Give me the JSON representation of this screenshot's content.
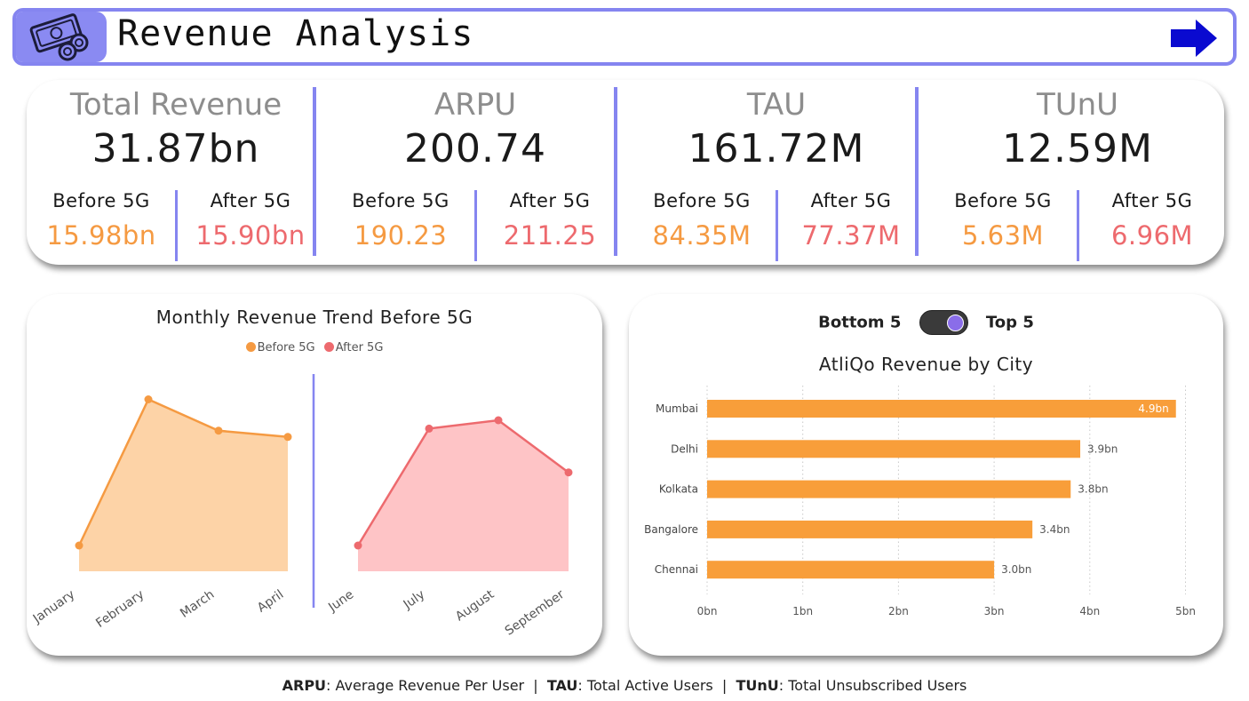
{
  "header": {
    "title": "Revenue Analysis",
    "icon": "money-icon",
    "nav_icon": "arrow-right-icon"
  },
  "kpis": [
    {
      "title": "Total Revenue",
      "value": "31.87bn",
      "before_label": "Before 5G",
      "before_value": "15.98bn",
      "after_label": "After 5G",
      "after_value": "15.90bn"
    },
    {
      "title": "ARPU",
      "value": "200.74",
      "before_label": "Before 5G",
      "before_value": "190.23",
      "after_label": "After 5G",
      "after_value": "211.25"
    },
    {
      "title": "TAU",
      "value": "161.72M",
      "before_label": "Before 5G",
      "before_value": "84.35M",
      "after_label": "After 5G",
      "after_value": "77.37M"
    },
    {
      "title": "TUnU",
      "value": "12.59M",
      "before_label": "Before 5G",
      "before_value": "5.63M",
      "after_label": "After 5G",
      "after_value": "6.96M"
    }
  ],
  "trend": {
    "title": "Monthly Revenue Trend Before 5G",
    "legend": [
      "Before 5G",
      "After 5G"
    ]
  },
  "toggle": {
    "left_label": "Bottom 5",
    "right_label": "Top 5",
    "state": "Top 5"
  },
  "city_chart_title": "AtliQo Revenue by City",
  "chart_data": [
    {
      "type": "area",
      "title": "Monthly Revenue Trend Before 5G",
      "categories": [
        "January",
        "February",
        "March",
        "April",
        "June",
        "July",
        "August",
        "September"
      ],
      "series": [
        {
          "name": "Before 5G",
          "x": [
            "January",
            "February",
            "March",
            "April"
          ],
          "values": [
            3.6,
            4.3,
            4.15,
            4.12
          ]
        },
        {
          "name": "After 5G",
          "x": [
            "June",
            "July",
            "August",
            "September"
          ],
          "values": [
            3.6,
            4.16,
            4.2,
            3.95
          ]
        }
      ],
      "colors": {
        "Before 5G": "#f59a42",
        "After 5G": "#ed6a6e"
      },
      "legend": "top-center",
      "grid": false
    },
    {
      "type": "bar",
      "orientation": "horizontal",
      "title": "AtliQo Revenue by City",
      "categories": [
        "Mumbai",
        "Delhi",
        "Kolkata",
        "Bangalore",
        "Chennai"
      ],
      "values": [
        4.9,
        3.9,
        3.8,
        3.4,
        3.0
      ],
      "data_labels": [
        "4.9bn",
        "3.9bn",
        "3.8bn",
        "3.4bn",
        "3.0bn"
      ],
      "xticks": [
        "0bn",
        "1bn",
        "2bn",
        "3bn",
        "4bn",
        "5bn"
      ],
      "xlim": [
        0,
        5
      ],
      "color": "#f89e3a",
      "grid": true
    }
  ],
  "footer": {
    "arpu_abbr": "ARPU",
    "arpu_text": ": Average Revenue Per User",
    "tau_abbr": "TAU",
    "tau_text": ": Total Active Users",
    "tunu_abbr": "TUnU",
    "tunu_text": ": Total Unsubscribed Users",
    "separator": "|"
  }
}
